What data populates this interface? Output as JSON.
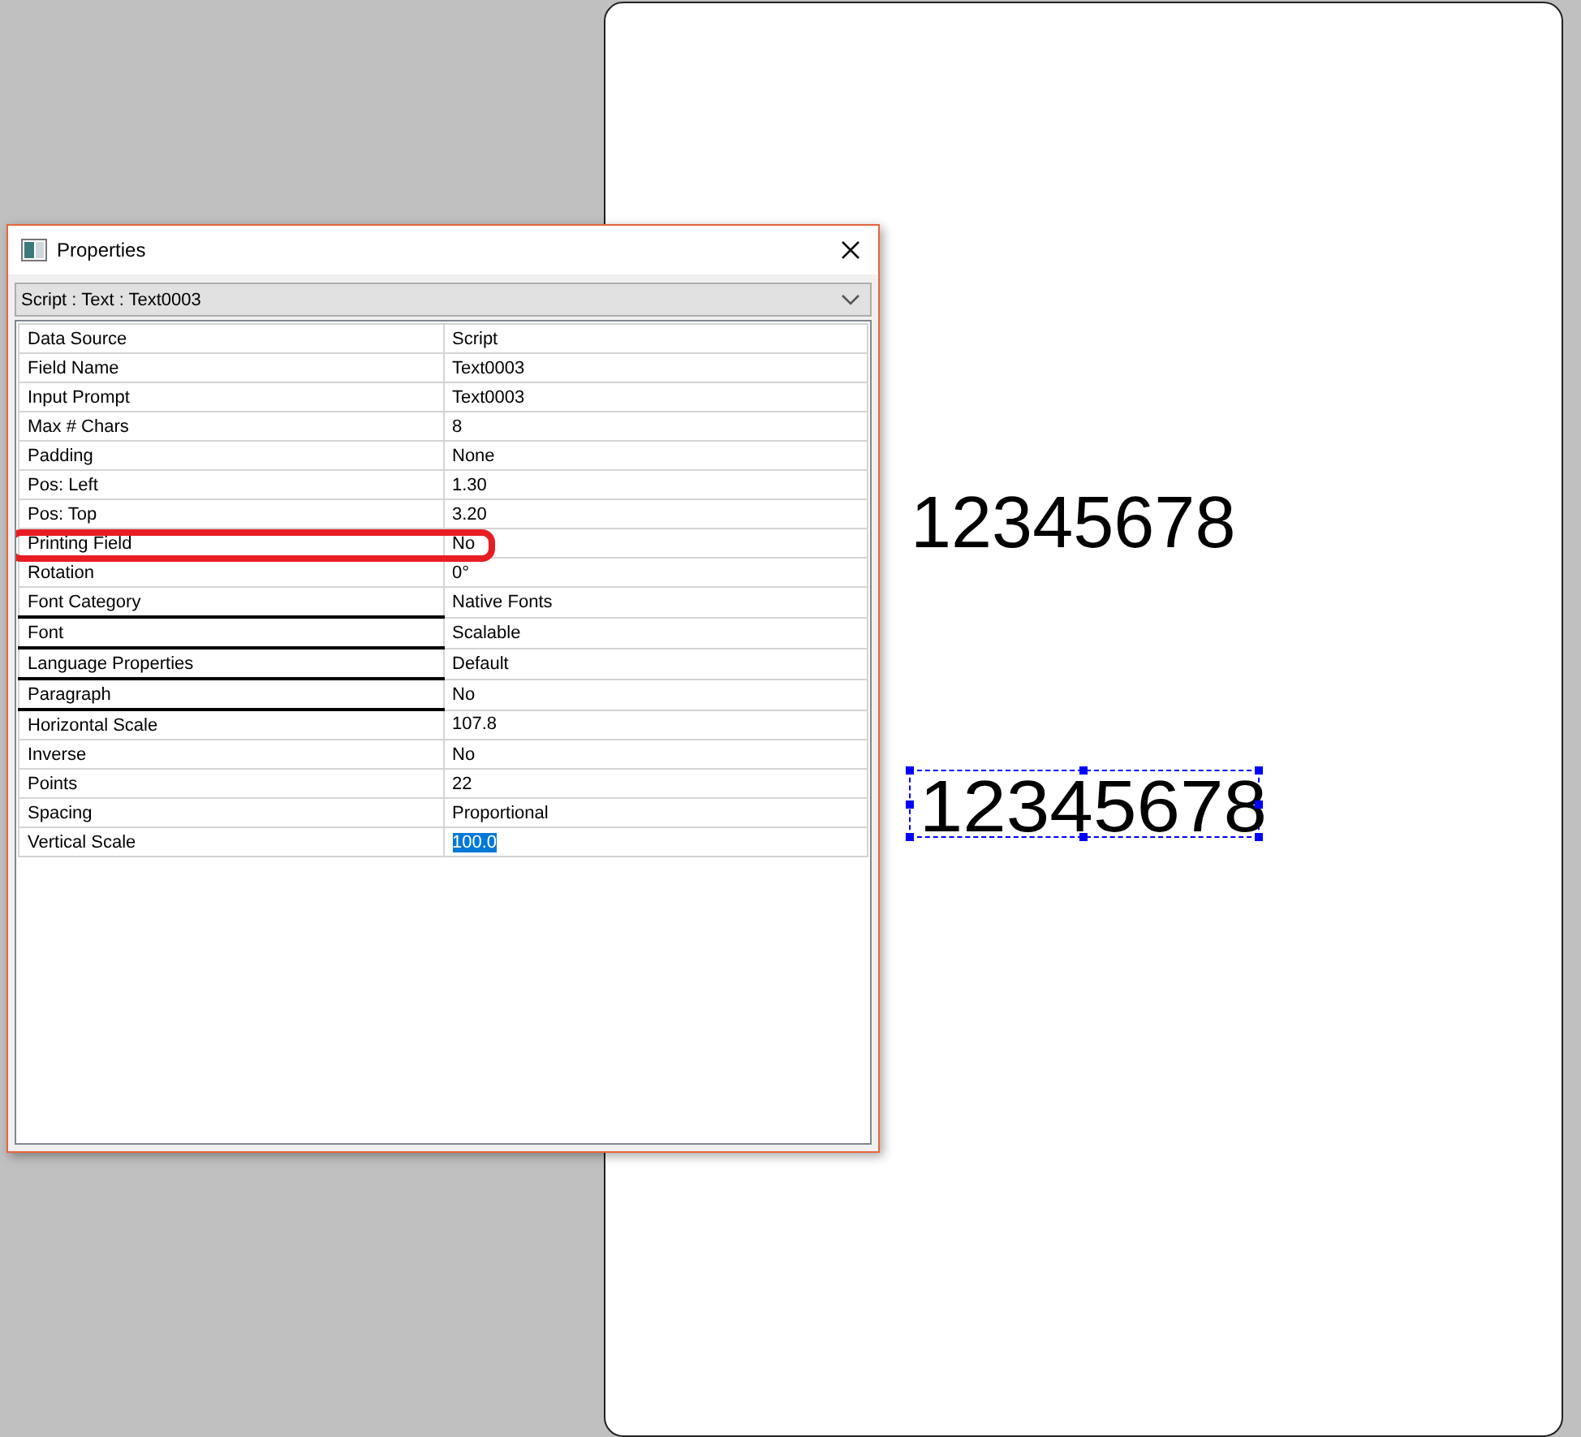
{
  "window": {
    "title": "Properties"
  },
  "object_selector": {
    "value": "Script : Text : Text0003"
  },
  "properties": [
    {
      "name": "Data Source",
      "value": "Script",
      "underlined": false,
      "highlighted": false,
      "selected": false
    },
    {
      "name": "Field Name",
      "value": "Text0003",
      "underlined": false,
      "highlighted": false,
      "selected": false
    },
    {
      "name": "Input Prompt",
      "value": "Text0003",
      "underlined": false,
      "highlighted": false,
      "selected": false
    },
    {
      "name": "Max # Chars",
      "value": "8",
      "underlined": false,
      "highlighted": false,
      "selected": false
    },
    {
      "name": "Padding",
      "value": "None",
      "underlined": false,
      "highlighted": false,
      "selected": false
    },
    {
      "name": "Pos: Left",
      "value": "1.30",
      "underlined": false,
      "highlighted": false,
      "selected": false
    },
    {
      "name": "Pos: Top",
      "value": "3.20",
      "underlined": false,
      "highlighted": false,
      "selected": false
    },
    {
      "name": "Printing Field",
      "value": "No",
      "underlined": false,
      "highlighted": true,
      "selected": false
    },
    {
      "name": "Rotation",
      "value": "0°",
      "underlined": false,
      "highlighted": false,
      "selected": false
    },
    {
      "name": "Font Category",
      "value": "Native Fonts",
      "underlined": true,
      "highlighted": false,
      "selected": false
    },
    {
      "name": "Font",
      "value": "Scalable",
      "underlined": true,
      "highlighted": false,
      "selected": false
    },
    {
      "name": "Language Properties",
      "value": "Default",
      "underlined": true,
      "highlighted": false,
      "selected": false
    },
    {
      "name": "Paragraph",
      "value": "No",
      "underlined": true,
      "highlighted": false,
      "selected": false
    },
    {
      "name": "Horizontal Scale",
      "value": "107.8",
      "underlined": false,
      "highlighted": false,
      "selected": false
    },
    {
      "name": "Inverse",
      "value": "No",
      "underlined": false,
      "highlighted": false,
      "selected": false
    },
    {
      "name": "Points",
      "value": "22",
      "underlined": false,
      "highlighted": false,
      "selected": false
    },
    {
      "name": "Spacing",
      "value": "Proportional",
      "underlined": false,
      "highlighted": false,
      "selected": false
    },
    {
      "name": "Vertical Scale",
      "value": "100.0",
      "underlined": false,
      "highlighted": false,
      "selected": true
    }
  ],
  "canvas": {
    "fields": [
      {
        "text": "12345678",
        "selected": false
      },
      {
        "text": "12345678",
        "selected": true
      }
    ]
  }
}
